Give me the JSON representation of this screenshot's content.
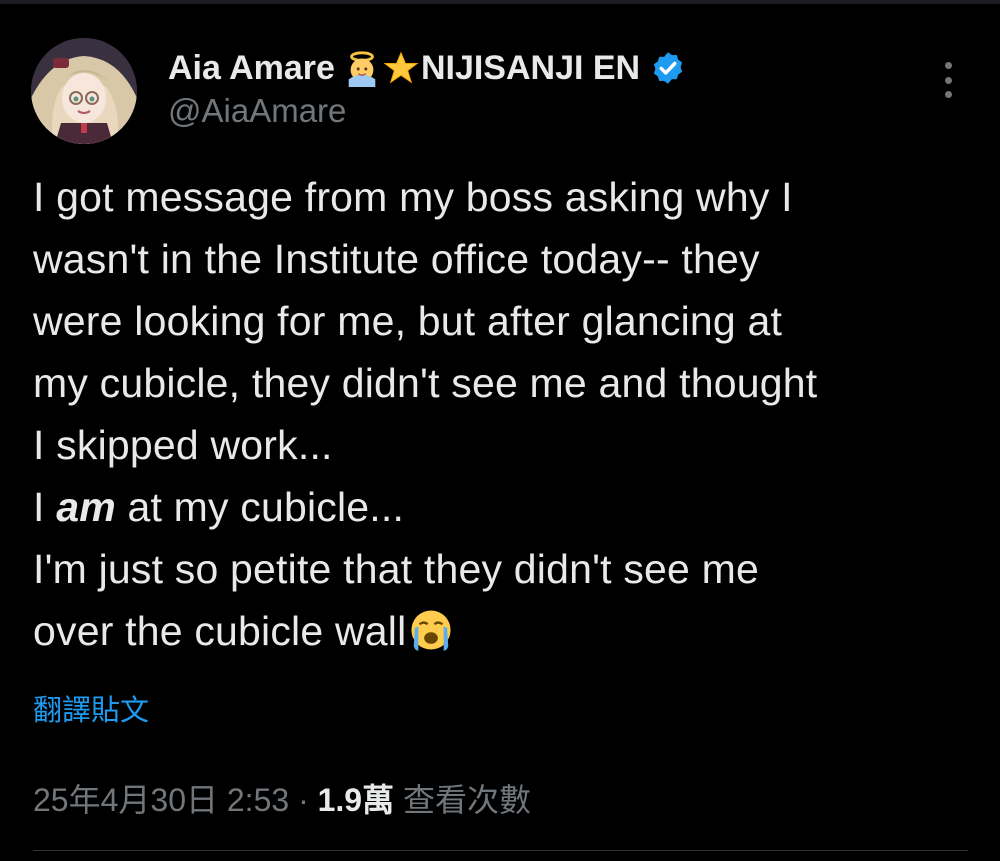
{
  "author": {
    "display_name": "Aia Amare",
    "org_suffix": "NIJISANJI EN",
    "handle": "@AiaAmare",
    "emoji_1": "baby-angel-icon",
    "emoji_2": "star-icon",
    "verified_color": "#1d9bf0"
  },
  "tweet": {
    "line1": "I got message from my boss asking why I",
    "line2": "wasn't in the Institute office today-- they",
    "line3": "were looking for me, but after glancing at",
    "line4": "my cubicle, they didn't see me and thought",
    "line5": "I skipped work...",
    "line6_pre": "I ",
    "line6_em": "am",
    "line6_post": " at my cubicle...",
    "line7": "I'm just so petite that they didn't see me",
    "line8": "over the cubicle wall",
    "end_emoji": "loudly-crying-face-icon"
  },
  "translate_label": "翻譯貼文",
  "meta": {
    "timestamp": "25年4月30日 2:53",
    "separator": " · ",
    "views_count": "1.9萬",
    "views_label": " 查看次數"
  },
  "colors": {
    "background": "#000000",
    "text": "#e7e9ea",
    "muted": "#71767b",
    "link": "#1d9bf0"
  }
}
